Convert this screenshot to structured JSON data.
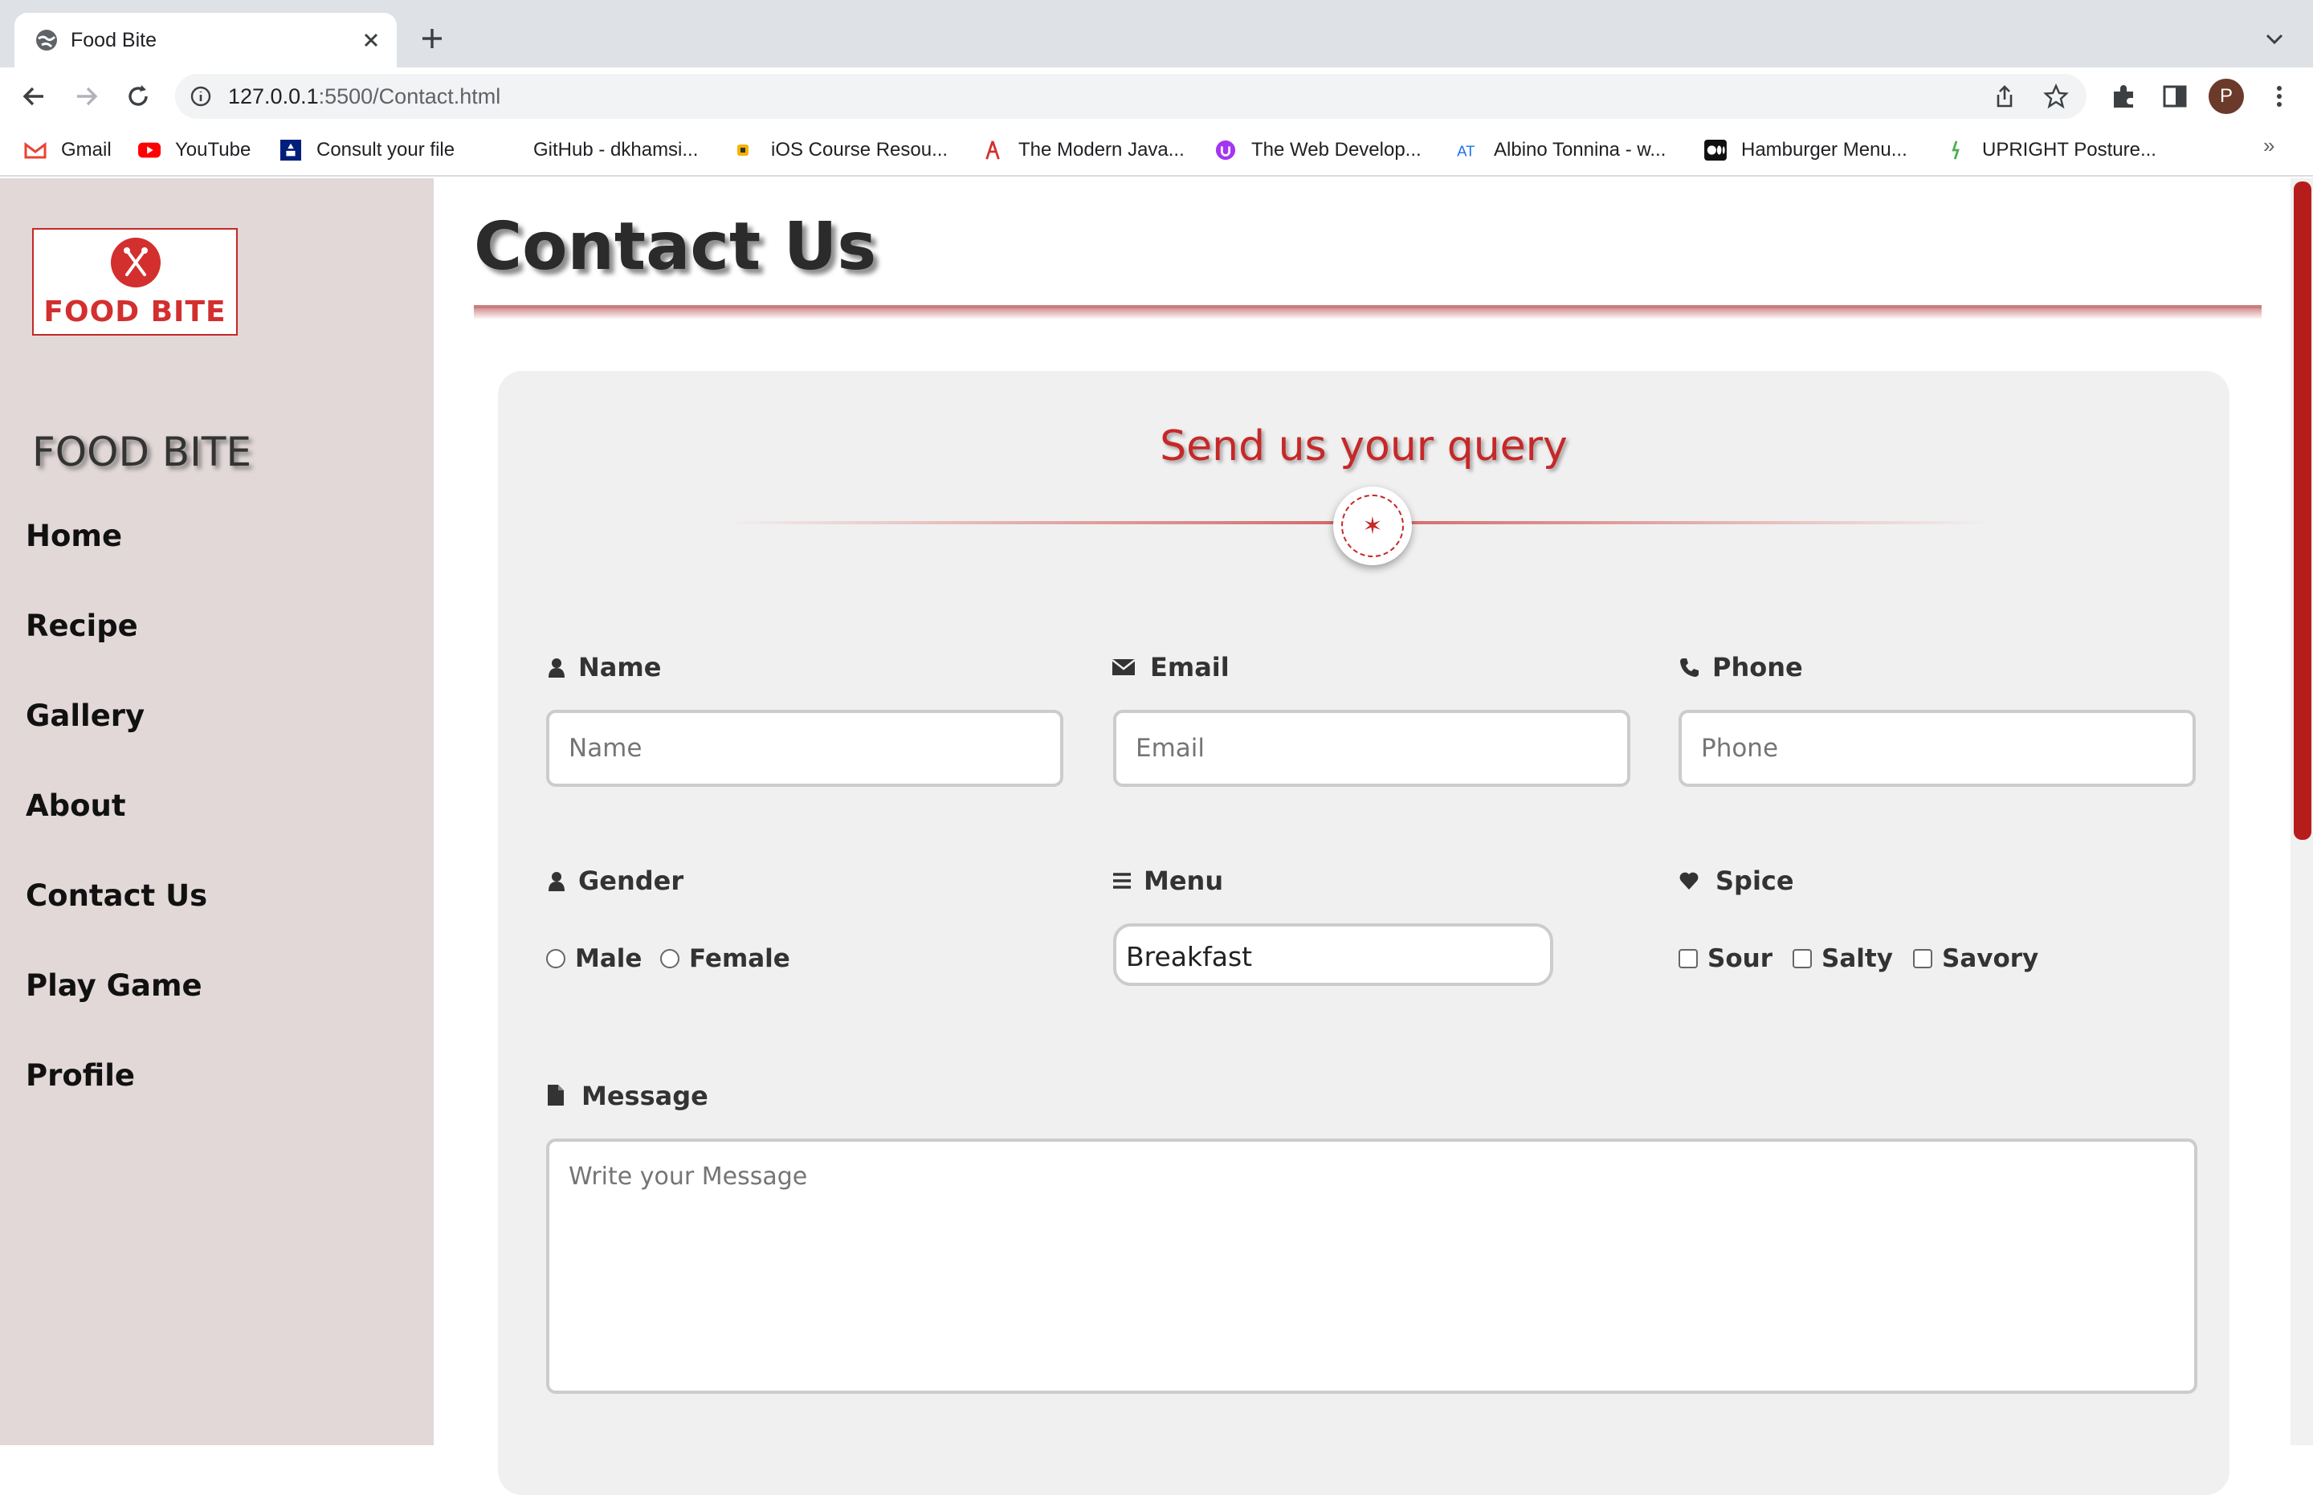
{
  "browser": {
    "tab_title": "Food Bite",
    "url_host": "127.0.0.1",
    "url_rest": ":5500/Contact.html",
    "profile_initial": "P",
    "bookmarks": [
      {
        "label": "Gmail",
        "icon": "gmail-icon"
      },
      {
        "label": "YouTube",
        "icon": "youtube-icon"
      },
      {
        "label": "Consult your file",
        "icon": "consult-icon"
      },
      {
        "label": "GitHub - dkhamsi...",
        "icon": "github-icon"
      },
      {
        "label": "iOS Course Resou...",
        "icon": "ios-icon"
      },
      {
        "label": "The Modern Java...",
        "icon": "js-icon"
      },
      {
        "label": "The Web Develop...",
        "icon": "udemy-icon"
      },
      {
        "label": "Albino Tonnina - w...",
        "icon": "at-icon"
      },
      {
        "label": "Hamburger Menu...",
        "icon": "medium-icon"
      },
      {
        "label": "UPRIGHT Posture...",
        "icon": "upright-icon"
      }
    ],
    "more_bookmarks": "»"
  },
  "sidebar": {
    "logo_text": "FOOD BITE",
    "brand": "FOOD BITE",
    "nav": [
      "Home",
      "Recipe",
      "Gallery",
      "About",
      "Contact Us",
      "Play Game",
      "Profile"
    ]
  },
  "main": {
    "title": "Contact Us",
    "form": {
      "heading": "Send us your query",
      "badge_glyph": "✶",
      "name": {
        "label": "Name",
        "placeholder": "Name"
      },
      "email": {
        "label": "Email",
        "placeholder": "Email"
      },
      "phone": {
        "label": "Phone",
        "placeholder": "Phone"
      },
      "gender": {
        "label": "Gender",
        "options": [
          "Male",
          "Female"
        ]
      },
      "menu": {
        "label": "Menu",
        "value": "Breakfast"
      },
      "spice": {
        "label": "Spice",
        "options": [
          "Sour",
          "Salty",
          "Savory"
        ]
      },
      "message": {
        "label": "Message",
        "placeholder": "Write your Message"
      }
    }
  },
  "colors": {
    "accent": "#c62828",
    "sidebar_bg": "#e2d8d8",
    "card_bg": "#f1f0f0"
  }
}
